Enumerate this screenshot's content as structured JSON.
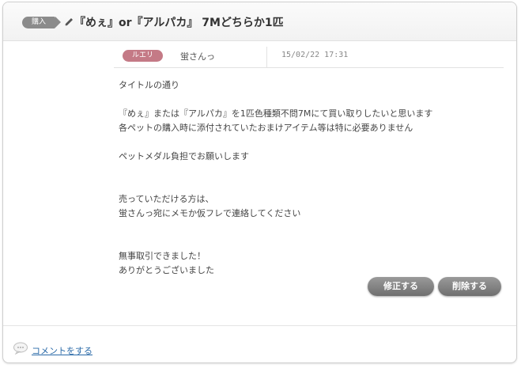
{
  "post": {
    "category_badge": "購入",
    "title": "『めぇ』or『アルパカ』 7Mどちらか1匹",
    "server_badge": "ルエリ",
    "author": "蛍さんっ",
    "timestamp": "15/02/22 17:31",
    "body_lines": [
      "タイトルの通り",
      "",
      "『めぇ』または『アルパカ』を1匹色種類不問7Mにて買い取りしたいと思います",
      "各ペットの購入時に添付されていたおまけアイテム等は特に必要ありません",
      "",
      "ペットメダル負担でお願いします",
      "",
      "",
      "売っていただける方は、",
      "蛍さんっ宛にメモか仮フレで連絡してください",
      "",
      "",
      "無事取引できました！",
      "ありがとうございました"
    ]
  },
  "actions": {
    "edit_label": "修正する",
    "delete_label": "削除する"
  },
  "footer": {
    "comment_label": "コメントをする"
  },
  "icons": {
    "title_icon": "pen-icon",
    "comment_icon": "speech-bubble-icon"
  },
  "colors": {
    "category_badge": "#8b8b8b",
    "server_badge": "#c47a86",
    "button": "#7f7f7f",
    "link": "#2a6aa8"
  }
}
